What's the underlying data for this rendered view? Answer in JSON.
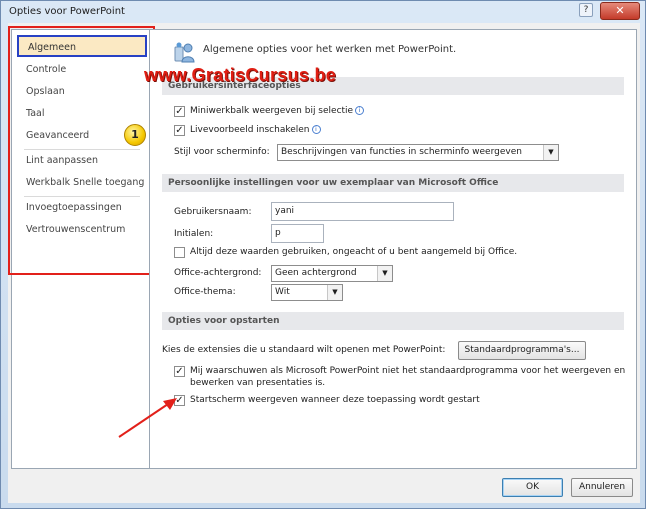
{
  "window": {
    "title": "Opties voor PowerPoint",
    "help_label": "?",
    "close_label": "✕"
  },
  "sidebar": {
    "badge": "1",
    "items": [
      {
        "label": "Algemeen"
      },
      {
        "label": "Controle"
      },
      {
        "label": "Opslaan"
      },
      {
        "label": "Taal"
      },
      {
        "label": "Geavanceerd"
      },
      {
        "label": "Lint aanpassen"
      },
      {
        "label": "Werkbalk Snelle toegang"
      },
      {
        "label": "Invoegtoepassingen"
      },
      {
        "label": "Vertrouwenscentrum"
      }
    ]
  },
  "main": {
    "intro_icon": "settings-people-icon",
    "intro_text": "Algemene opties voor het werken met PowerPoint.",
    "watermark": "www.GratisCursus.be",
    "ui_section": {
      "header": "Gebruikersinterfaceopties",
      "mini_toolbar": {
        "label": "Miniwerkbalk weergeven bij selectie",
        "checked": true
      },
      "live_preview": {
        "label": "Livevoorbeeld inschakelen",
        "checked": true
      },
      "tooltip_style": {
        "label": "Stijl voor scherminfo:",
        "value": "Beschrijvingen van functies in scherminfo weergeven"
      }
    },
    "personal_section": {
      "header": "Persoonlijke instellingen voor uw exemplaar van Microsoft Office",
      "username": {
        "label": "Gebruikersnaam:",
        "value": "yani"
      },
      "initials": {
        "label": "Initialen:",
        "value": "p"
      },
      "always_use": {
        "label": "Altijd deze waarden gebruiken, ongeacht of u bent aangemeld bij Office.",
        "checked": false
      },
      "background": {
        "label": "Office-achtergrond:",
        "value": "Geen achtergrond"
      },
      "theme": {
        "label": "Office-thema:",
        "value": "Wit"
      }
    },
    "startup_section": {
      "header": "Opties voor opstarten",
      "extensions_text": "Kies de extensies die u standaard wilt openen met PowerPoint:",
      "default_programs_button": "Standaardprogramma's...",
      "warn_default": {
        "label": "Mij waarschuwen als Microsoft PowerPoint niet het standaardprogramma voor het weergeven en bewerken van presentaties is.",
        "checked": true
      },
      "show_start_screen": {
        "label": "Startscherm weergeven wanneer deze toepassing wordt gestart",
        "checked": true
      }
    }
  },
  "footer": {
    "ok_label": "OK",
    "cancel_label": "Annuleren"
  },
  "colors": {
    "highlight_outline": "#e2201a",
    "selected_border": "#2741c4",
    "arrow": "#e2201a"
  }
}
